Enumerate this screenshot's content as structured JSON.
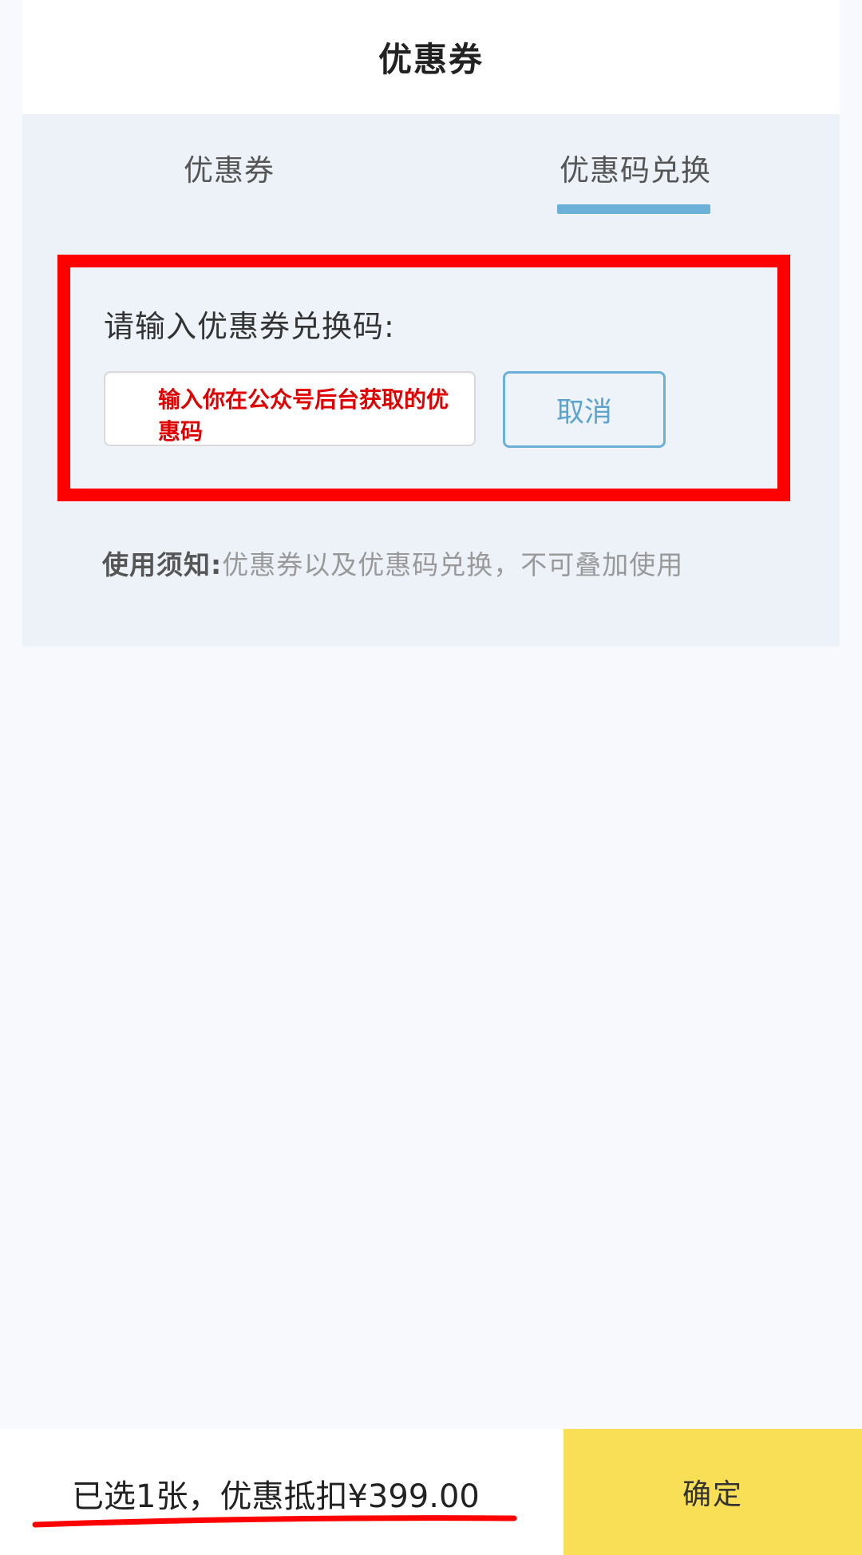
{
  "header": {
    "title": "优惠券"
  },
  "tabs": [
    {
      "label": "优惠券",
      "active": false
    },
    {
      "label": "优惠码兑换",
      "active": true
    }
  ],
  "redeem": {
    "prompt": "请输入优惠券兑换码:",
    "input_value": "输入你在公众号后台获取的优惠码",
    "cancel_label": "取消"
  },
  "notice": {
    "label": "使用须知:",
    "text": "优惠券以及优惠码兑换，不可叠加使用"
  },
  "footer": {
    "summary": "已选1张，优惠抵扣¥399.00",
    "confirm_label": "确定"
  },
  "colors": {
    "accent": "#6ab0d8",
    "annotation_red": "#ff0000",
    "confirm_bg": "#f9df56"
  }
}
